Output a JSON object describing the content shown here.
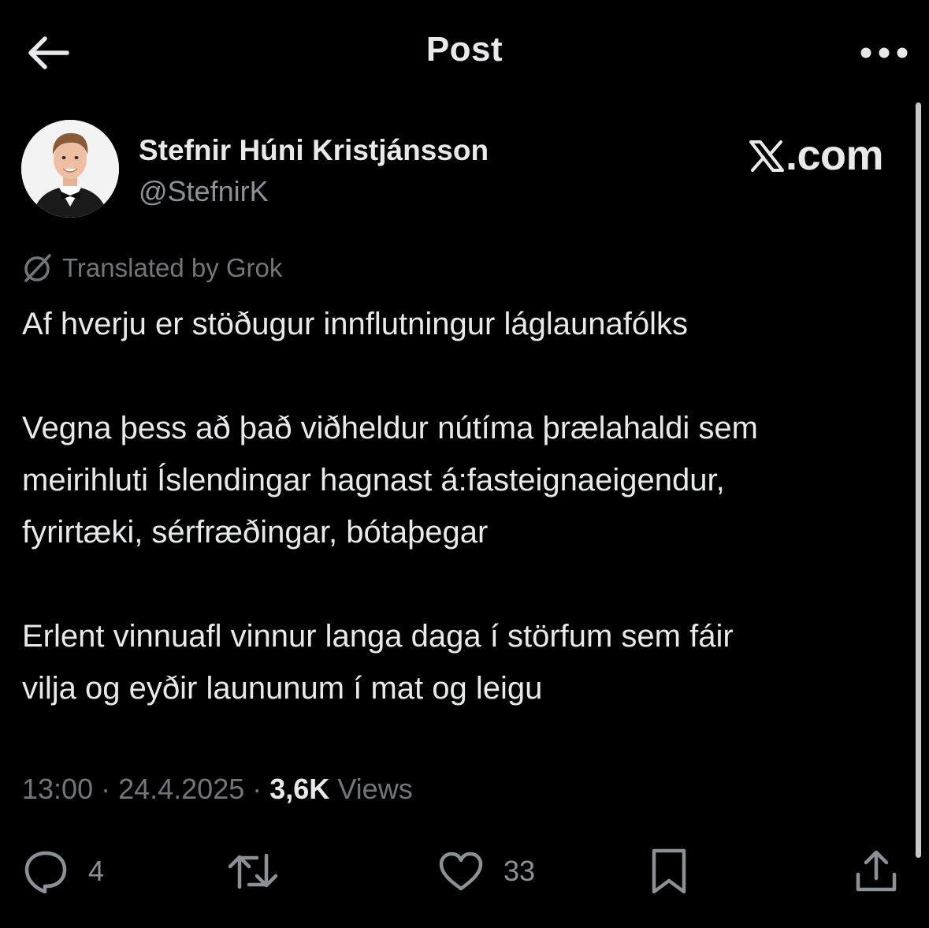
{
  "header": {
    "title": "Post",
    "back_icon": "arrow-left-icon",
    "more_icon": "more-dots-icon"
  },
  "author": {
    "name": "Stefnir Húni Kristjánsson",
    "handle": "@StefnirK"
  },
  "brand": {
    "text": ".com"
  },
  "translation": {
    "label": "Translated by Grok",
    "icon": "translate-icon"
  },
  "post": {
    "paragraphs": [
      {
        "lines": [
          "Af hverju er stöðugur innflutningur láglaunafólks"
        ]
      },
      {
        "lines": [
          "Vegna þess að það viðheldur nútíma þrælahaldi sem",
          "meirihluti Íslendingar hagnast á:fasteignaeigendur,",
          "fyrirtæki, sérfræðingar, bótaþegar"
        ]
      },
      {
        "lines": [
          "Erlent vinnuafl vinnur langa daga í störfum sem fáir",
          "vilja og eyðir laununum í mat og leigu"
        ]
      }
    ]
  },
  "meta": {
    "time": "13:00",
    "separator": " · ",
    "date": "24.4.2025",
    "views_count": "3,6K",
    "views_label": "Views"
  },
  "actions": {
    "reply_count": "4",
    "like_count": "33"
  },
  "colors": {
    "background": "#000000",
    "text_primary": "#e7e9ea",
    "text_secondary": "#71767b"
  }
}
